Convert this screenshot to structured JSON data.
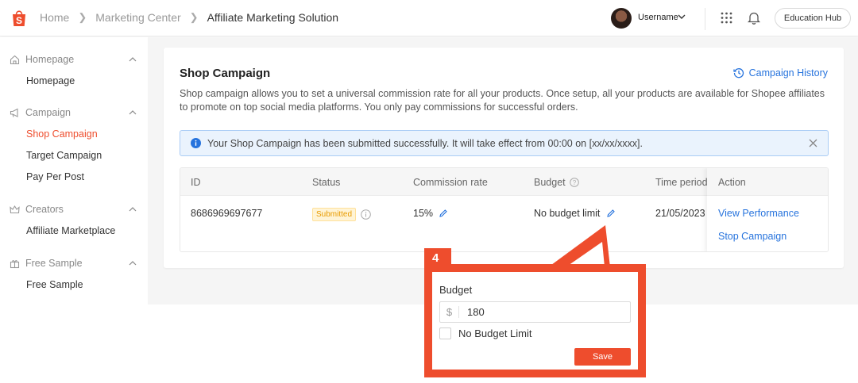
{
  "header": {
    "breadcrumbs": [
      "Home",
      "Marketing Center",
      "Affiliate Marketing Solution"
    ],
    "username": "Username",
    "education_hub": "Education Hub",
    "icons": [
      "shopee-logo-icon",
      "chevron-right-icon",
      "chevron-down-icon",
      "apps-grid-icon",
      "bell-icon"
    ]
  },
  "sidebar": {
    "groups": [
      {
        "title": "Homepage",
        "icon": "home-icon",
        "items": [
          {
            "label": "Homepage",
            "active": false
          }
        ]
      },
      {
        "title": "Campaign",
        "icon": "megaphone-icon",
        "items": [
          {
            "label": "Shop Campaign",
            "active": true
          },
          {
            "label": "Target Campaign",
            "active": false
          },
          {
            "label": "Pay Per Post",
            "active": false
          }
        ]
      },
      {
        "title": "Creators",
        "icon": "crown-icon",
        "items": [
          {
            "label": "Affiliate Marketplace",
            "active": false
          }
        ]
      },
      {
        "title": "Free Sample",
        "icon": "gift-icon",
        "items": [
          {
            "label": "Free Sample",
            "active": false
          }
        ]
      }
    ]
  },
  "main": {
    "title": "Shop Campaign",
    "history_link": "Campaign History",
    "description": "Shop campaign allows you to set a universal commission rate for all your products. Once setup, all your products are available for Shopee affiliates to promote on top social media platforms. You only pay commissions for successful orders.",
    "alert": "Your Shop Campaign has been submitted successfully. It will take effect from 00:00 on [xx/xx/xxxx].",
    "table": {
      "headers": {
        "id": "ID",
        "status": "Status",
        "commission": "Commission rate",
        "budget": "Budget",
        "time": "Time period",
        "action": "Action"
      },
      "row": {
        "id": "8686969697677",
        "status": "Submitted",
        "commission": "15%",
        "budget": "No budget limit",
        "time": "21/05/2023",
        "actions": [
          "View Performance",
          "Stop Campaign"
        ]
      }
    }
  },
  "callout": {
    "step": "4",
    "budget_label": "Budget",
    "currency_prefix": "$",
    "budget_value": "180",
    "no_limit_label": "No Budget Limit",
    "no_limit_checked": false,
    "save_label": "Save"
  },
  "colors": {
    "accent": "#ee4d2d",
    "link": "#2673dd",
    "alert_bg": "#eaf3fd"
  }
}
